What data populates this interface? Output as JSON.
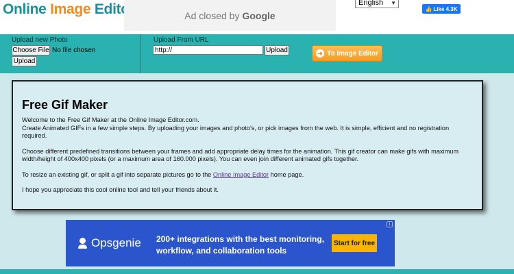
{
  "header": {
    "logo_word1": "Online",
    "logo_word2": "Image",
    "logo_word3": "Editor",
    "ad_text": "Ad closed by",
    "ad_brand": "Google",
    "language": "English",
    "fb_like_label": "Like 4.3K"
  },
  "upload": {
    "photo_label": "Upload new Photo",
    "choose_file_label": "Choose File",
    "no_file_text": "No file chosen",
    "upload_button": "Upload",
    "url_label": "Upload From URL",
    "url_value": "http://",
    "url_upload_button": "Upload",
    "to_editor_button": "To Image Editor"
  },
  "content": {
    "title": "Free Gif Maker",
    "p1_line1": "Welcome to the Free Gif Maker at the Online Image Editor.com.",
    "p1_line2": "Create Animated GIFs in a few simple steps. By uploading your images and photo's, or pick images from the web. It is simple, efficient and no registration required.",
    "p2": "Choose different predefined transitions between your frames and add appropriate delay times for the animation. This gif creator can make gifs with maximum width/height of 400x400 pixels (or a maximum area of 160.000 pixels). You can even join different animated gifs together.",
    "p3_before": "To resize an existing gif, or split a gif into separate pictures go to the ",
    "p3_link": "Online Image Editor",
    "p3_after": " home page.",
    "p4": "I hope you appreciate this cool online tool and tell your friends about it."
  },
  "ad_bottom": {
    "brand": "Opsgenie",
    "text": "200+ integrations with the best monitoring, workflow, and collaboration tools",
    "cta": "Start for free",
    "info_icon": "i"
  },
  "colors": {
    "teal": "#29b2b0",
    "orange": "#f28c1a",
    "ad_blue": "#2b55cc",
    "cta_yellow": "#f7b500",
    "page_bg": "#cfe8ec"
  }
}
